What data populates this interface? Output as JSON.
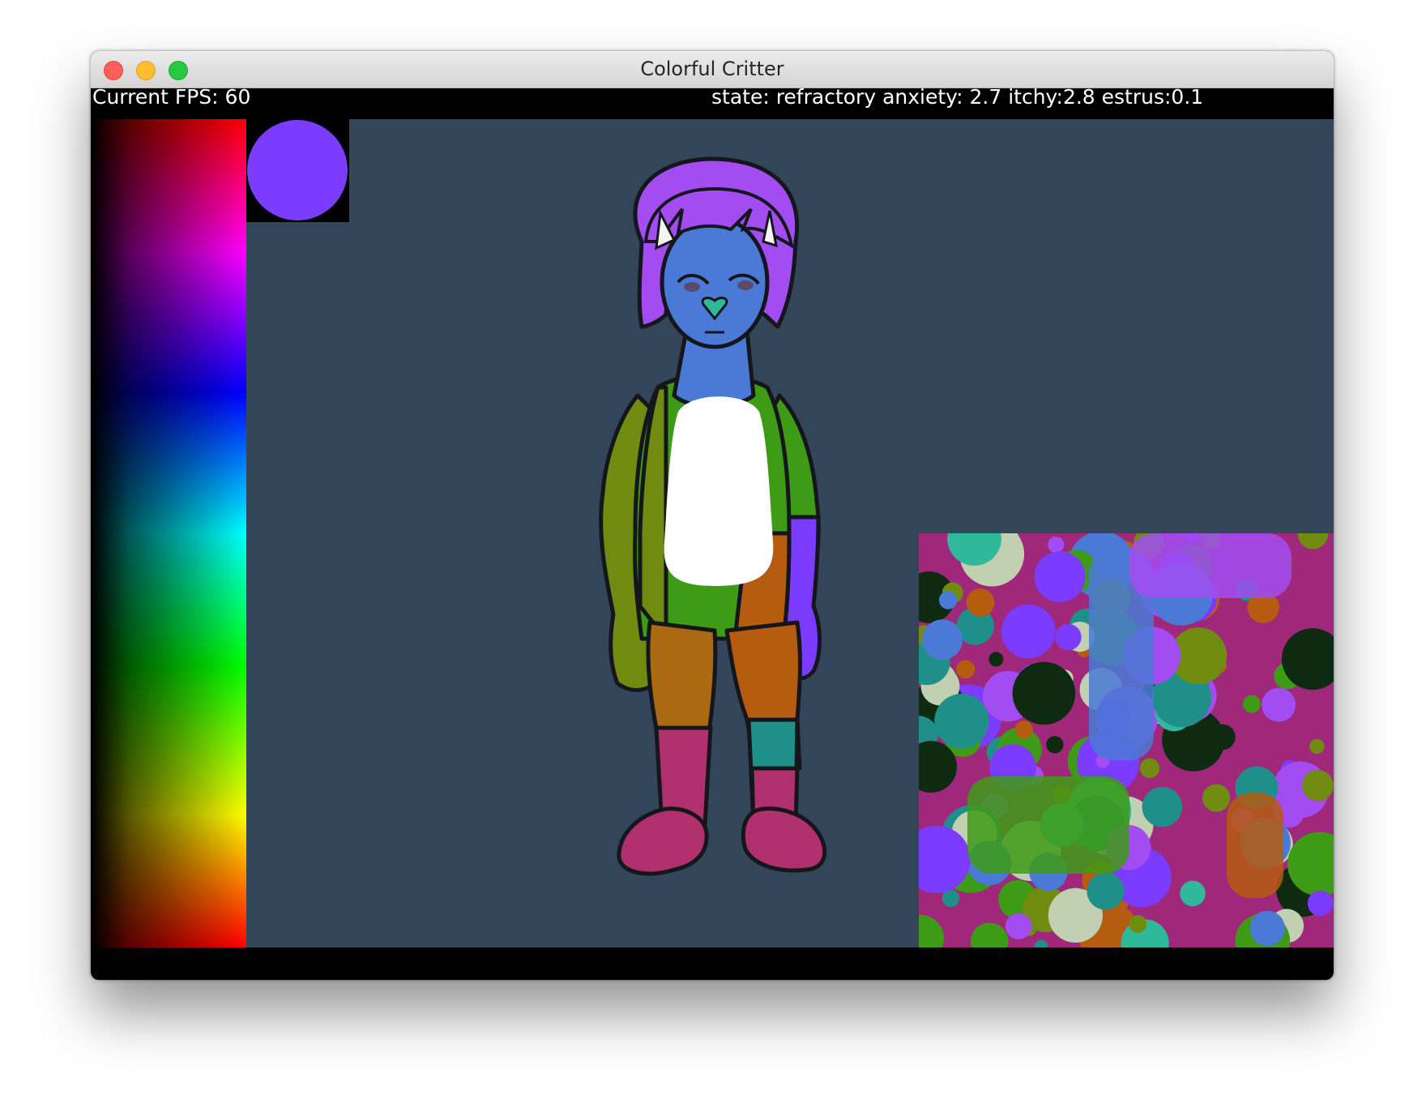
{
  "window": {
    "title": "Colorful Critter"
  },
  "hud": {
    "fps_text": "Current FPS: 60",
    "state_text": "state: refractory anxiety: 2.7 itchy:2.8 estrus:0.1"
  },
  "colors": {
    "background": "#334558",
    "selected_color": "#7c3cff",
    "hair": "#a24cf2",
    "head": "#4a7ad6",
    "belly": "#ffffff",
    "left_arm": "#6f8b10",
    "right_arm": "#3e9b16",
    "right_hand": "#7c3cff",
    "hip_orange": "#b55c10",
    "left_leg": "#ab6a12",
    "right_leg_teal": "#1f8f8a",
    "boots": "#b0306e",
    "nose": "#2fb89a"
  },
  "icons": {
    "close": "close-icon",
    "minimize": "minimize-icon",
    "maximize": "maximize-icon"
  }
}
